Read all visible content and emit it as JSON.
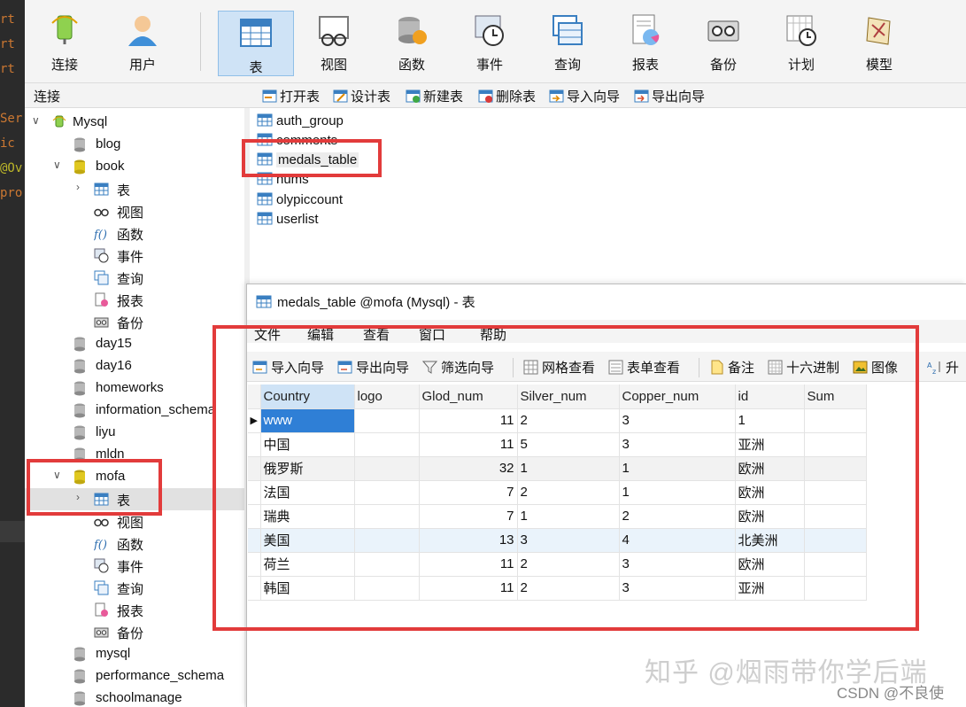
{
  "code_strip": {
    "lines": [
      {
        "text": "rt",
        "color": "#cc7832"
      },
      {
        "text": "rt",
        "color": "#cc7832"
      },
      {
        "text": "rt",
        "color": "#cc7832"
      },
      {
        "text": "Ser",
        "color": "#cc7832"
      },
      {
        "text": "ic",
        "color": "#cc7832"
      },
      {
        "text": "@Ov",
        "color": "#bbb529"
      },
      {
        "text": "pro",
        "color": "#cc7832"
      }
    ]
  },
  "toolbar": {
    "buttons": [
      {
        "label": "连接",
        "icon": "connection-icon"
      },
      {
        "label": "用户",
        "icon": "user-icon"
      },
      {
        "label": "表",
        "icon": "table-icon",
        "active": true
      },
      {
        "label": "视图",
        "icon": "view-icon"
      },
      {
        "label": "函数",
        "icon": "function-icon"
      },
      {
        "label": "事件",
        "icon": "event-icon"
      },
      {
        "label": "查询",
        "icon": "query-icon"
      },
      {
        "label": "报表",
        "icon": "report-icon"
      },
      {
        "label": "备份",
        "icon": "backup-icon"
      },
      {
        "label": "计划",
        "icon": "schedule-icon"
      },
      {
        "label": "模型",
        "icon": "model-icon"
      }
    ]
  },
  "sidebar": {
    "header": "连接",
    "tree": [
      {
        "label": "Mysql",
        "icon": "mysql-connection-icon",
        "arrow": "open",
        "level": 0
      },
      {
        "label": "blog",
        "icon": "database-icon",
        "level": 1
      },
      {
        "label": "book",
        "icon": "database-open-icon",
        "arrow": "open",
        "level": 1
      },
      {
        "label": "表",
        "icon": "table-folder-icon",
        "arrow": "closed",
        "level": 2
      },
      {
        "label": "视图",
        "icon": "view-folder-icon",
        "level": 2
      },
      {
        "label": "函数",
        "icon": "function-folder-icon",
        "level": 2
      },
      {
        "label": "事件",
        "icon": "event-folder-icon",
        "level": 2
      },
      {
        "label": "查询",
        "icon": "query-folder-icon",
        "level": 2
      },
      {
        "label": "报表",
        "icon": "report-folder-icon",
        "level": 2
      },
      {
        "label": "备份",
        "icon": "backup-folder-icon",
        "level": 2
      },
      {
        "label": "day15",
        "icon": "database-icon",
        "level": 1
      },
      {
        "label": "day16",
        "icon": "database-icon",
        "level": 1
      },
      {
        "label": "homeworks",
        "icon": "database-icon",
        "level": 1
      },
      {
        "label": "information_schema",
        "icon": "database-icon",
        "level": 1
      },
      {
        "label": "liyu",
        "icon": "database-icon",
        "level": 1
      },
      {
        "label": "mldn",
        "icon": "database-icon",
        "level": 1
      },
      {
        "label": "mofa",
        "icon": "database-open-icon",
        "arrow": "open",
        "level": 1
      },
      {
        "label": "表",
        "icon": "table-folder-icon",
        "arrow": "closed",
        "level": 2,
        "selected": true
      },
      {
        "label": "视图",
        "icon": "view-folder-icon",
        "level": 2
      },
      {
        "label": "函数",
        "icon": "function-folder-icon",
        "level": 2
      },
      {
        "label": "事件",
        "icon": "event-folder-icon",
        "level": 2
      },
      {
        "label": "查询",
        "icon": "query-folder-icon",
        "level": 2
      },
      {
        "label": "报表",
        "icon": "report-folder-icon",
        "level": 2
      },
      {
        "label": "备份",
        "icon": "backup-folder-icon",
        "level": 2
      },
      {
        "label": "mysql",
        "icon": "database-icon",
        "level": 1
      },
      {
        "label": "performance_schema",
        "icon": "database-icon",
        "level": 1
      },
      {
        "label": "schoolmanage",
        "icon": "database-icon",
        "level": 1
      }
    ]
  },
  "object_toolbar": {
    "buttons": [
      {
        "label": "打开表",
        "icon": "open-table-icon"
      },
      {
        "label": "设计表",
        "icon": "design-table-icon"
      },
      {
        "label": "新建表",
        "icon": "new-table-icon"
      },
      {
        "label": "删除表",
        "icon": "delete-table-icon"
      },
      {
        "label": "导入向导",
        "icon": "import-wizard-icon"
      },
      {
        "label": "导出向导",
        "icon": "export-wizard-icon"
      }
    ]
  },
  "object_list": {
    "items": [
      {
        "label": "auth_group"
      },
      {
        "label": "comments"
      },
      {
        "label": "medals_table",
        "selected": true
      },
      {
        "label": "nums"
      },
      {
        "label": "olypiccount"
      },
      {
        "label": "userlist"
      }
    ]
  },
  "table_window": {
    "title": "medals_table @mofa (Mysql) - 表",
    "menu": [
      "文件",
      "编辑",
      "查看",
      "窗口",
      "帮助"
    ],
    "tools": [
      {
        "label": "导入向导",
        "icon": "import-wizard-icon"
      },
      {
        "label": "导出向导",
        "icon": "export-wizard-icon"
      },
      {
        "label": "筛选向导",
        "icon": "filter-icon"
      },
      {
        "label": "网格查看",
        "icon": "grid-view-icon"
      },
      {
        "label": "表单查看",
        "icon": "form-view-icon"
      },
      {
        "label": "备注",
        "icon": "memo-icon"
      },
      {
        "label": "十六进制",
        "icon": "hex-icon"
      },
      {
        "label": "图像",
        "icon": "image-icon"
      },
      {
        "label": "升",
        "icon": "sort-asc-icon"
      }
    ],
    "columns": [
      "Country",
      "logo",
      "Glod_num",
      "Silver_num",
      "Copper_num",
      "id",
      "Sum"
    ],
    "rows": [
      [
        "www",
        "",
        "11",
        "2",
        "3",
        "1",
        ""
      ],
      [
        "中国",
        "",
        "11",
        "5",
        "3",
        "亚洲",
        ""
      ],
      [
        "俄罗斯",
        "",
        "32",
        "1",
        "1",
        "欧洲",
        ""
      ],
      [
        "法国",
        "",
        "7",
        "2",
        "1",
        "欧洲",
        ""
      ],
      [
        "瑞典",
        "",
        "7",
        "1",
        "2",
        "欧洲",
        ""
      ],
      [
        "美国",
        "",
        "13",
        "3",
        "4",
        "北美洲",
        ""
      ],
      [
        "荷兰",
        "",
        "11",
        "2",
        "3",
        "欧洲",
        ""
      ],
      [
        "韩国",
        "",
        "11",
        "2",
        "3",
        "亚洲",
        ""
      ]
    ]
  },
  "watermark": {
    "main": "知乎 @烟雨带你学后端",
    "sub": "CSDN @不良使"
  },
  "colors": {
    "annotation_red": "#e23b3b",
    "selection_blue": "#2f7fd6",
    "active_tab": "#cfe3f6"
  }
}
